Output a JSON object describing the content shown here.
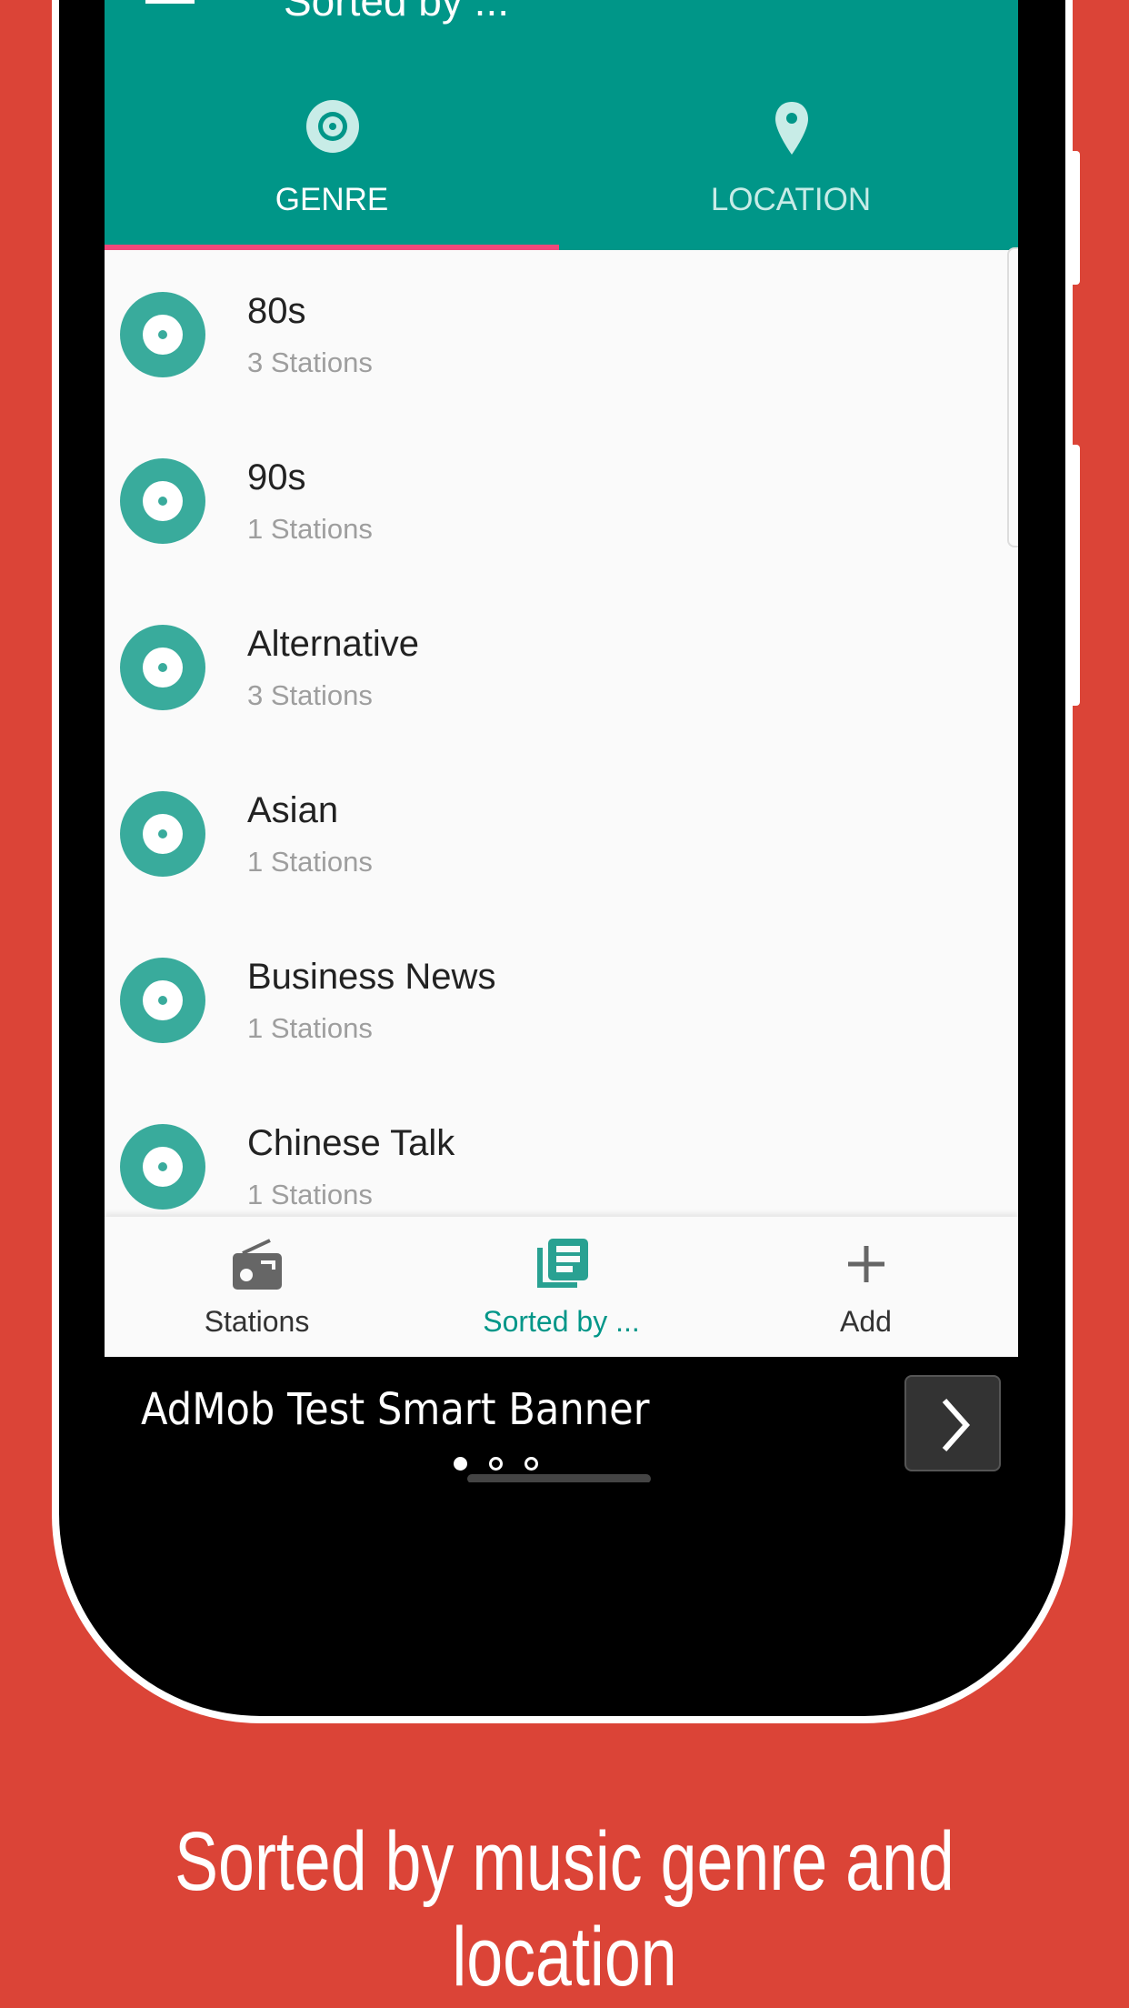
{
  "colors": {
    "background": "#DB4437",
    "primary": "#009688",
    "accent": "#F0487A",
    "icon": "#39AB9C"
  },
  "app_bar": {
    "title": "Sorted by ...",
    "menu_icon": "hamburger-icon"
  },
  "tabs": [
    {
      "label": "GENRE",
      "icon": "disc-icon",
      "active": true
    },
    {
      "label": "LOCATION",
      "icon": "location-pin-icon",
      "active": false
    }
  ],
  "genres": [
    {
      "name": "80s",
      "count": "3 Stations"
    },
    {
      "name": "90s",
      "count": "1 Stations"
    },
    {
      "name": "Alternative",
      "count": "3 Stations"
    },
    {
      "name": "Asian",
      "count": "1 Stations"
    },
    {
      "name": "Business News",
      "count": "1 Stations"
    },
    {
      "name": "Chinese Talk",
      "count": "1 Stations"
    }
  ],
  "bottom_nav": [
    {
      "label": "Stations",
      "icon": "radio-icon",
      "active": false
    },
    {
      "label": "Sorted by ...",
      "icon": "library-books-icon",
      "active": true
    },
    {
      "label": "Add",
      "icon": "plus-icon",
      "active": false
    }
  ],
  "ad": {
    "text": "AdMob Test Smart Banner"
  },
  "caption": "Sorted by music genre and location"
}
